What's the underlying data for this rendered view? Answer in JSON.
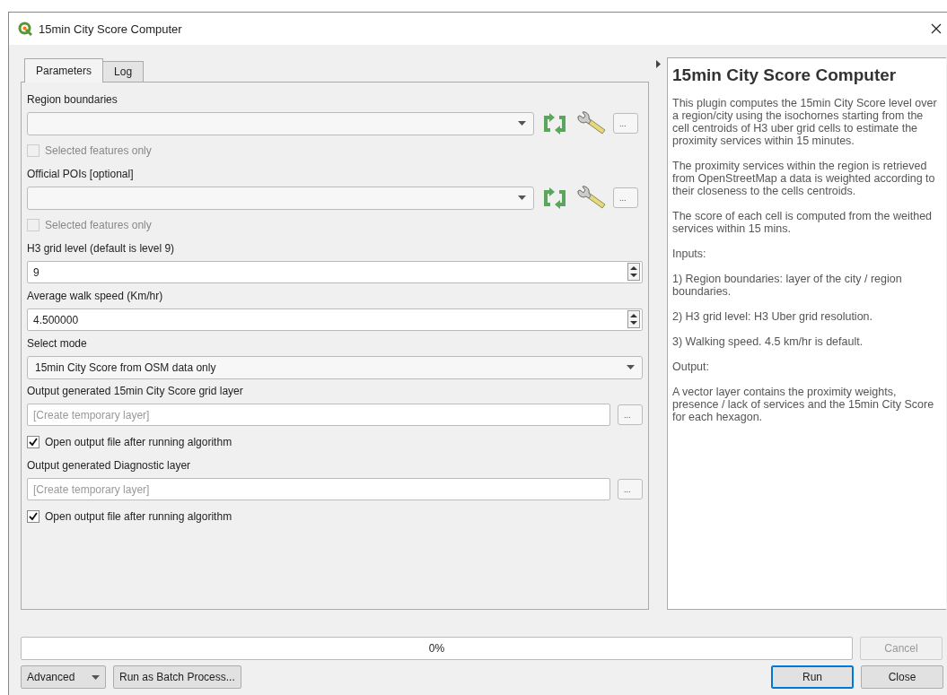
{
  "window": {
    "title": "15min City Score Computer"
  },
  "tabs": [
    {
      "label": "Parameters",
      "selected": true
    },
    {
      "label": "Log",
      "selected": false
    }
  ],
  "parameters": [
    {
      "kind": "label",
      "text": "Region boundaries"
    },
    {
      "kind": "layer",
      "browse": "..."
    },
    {
      "kind": "checkbox",
      "label": "Selected features only",
      "checked": false,
      "disabled": true
    },
    {
      "kind": "label",
      "text": "Official POIs [optional]"
    },
    {
      "kind": "layer",
      "browse": "..."
    },
    {
      "kind": "checkbox",
      "label": "Selected features only",
      "checked": false,
      "disabled": true
    },
    {
      "kind": "label",
      "text": "H3 grid level (default is level 9)"
    },
    {
      "kind": "spin",
      "value": "9"
    },
    {
      "kind": "label",
      "text": "Average walk speed (Km/hr)"
    },
    {
      "kind": "spin",
      "value": "4.500000"
    },
    {
      "kind": "label",
      "text": "Select mode"
    },
    {
      "kind": "select",
      "value": "15min City Score from OSM data only"
    },
    {
      "kind": "label",
      "text": "Output generated 15min City Score grid layer"
    },
    {
      "kind": "output",
      "placeholder": "[Create temporary layer]",
      "browse": "..."
    },
    {
      "kind": "checkbox",
      "label": "Open output file after running algorithm",
      "checked": true,
      "disabled": false
    },
    {
      "kind": "label",
      "text": "Output generated Diagnostic layer"
    },
    {
      "kind": "output",
      "placeholder": "[Create temporary layer]",
      "browse": "..."
    },
    {
      "kind": "checkbox",
      "label": "Open output file after running algorithm",
      "checked": true,
      "disabled": false
    }
  ],
  "help": {
    "title": "15min City Score Computer",
    "paragraphs": [
      "This plugin computes the 15min City Score level over a region/city using the isochornes starting from the cell centroids of H3 uber grid cells to estimate the proximity services within 15 minutes.",
      "The proximity services within the region is retrieved from OpenStreetMap a data is weighted according to their closeness to the cells centroids.",
      "The score of each cell is computed from the weithed services within 15 mins.",
      "Inputs:",
      "1) Region boundaries: layer of the city / region boundaries.",
      "2) H3 grid level: H3 Uber grid resolution.",
      "3) Walking speed. 4.5 km/hr is default.",
      "Output:",
      "A vector layer contains the proximity weights, presence / lack of services and the 15min City Score for each hexagon."
    ]
  },
  "progress": {
    "level": 0,
    "text": "0%"
  },
  "cancel": {
    "label": "Cancel",
    "disabled": true
  },
  "left_buttons": [
    {
      "kind": "menu",
      "label": "Advanced"
    },
    {
      "kind": "plain",
      "label": "Run as Batch Process..."
    }
  ],
  "right_buttons": [
    {
      "label": "Run",
      "default": true
    },
    {
      "label": "Close",
      "default": false
    }
  ]
}
